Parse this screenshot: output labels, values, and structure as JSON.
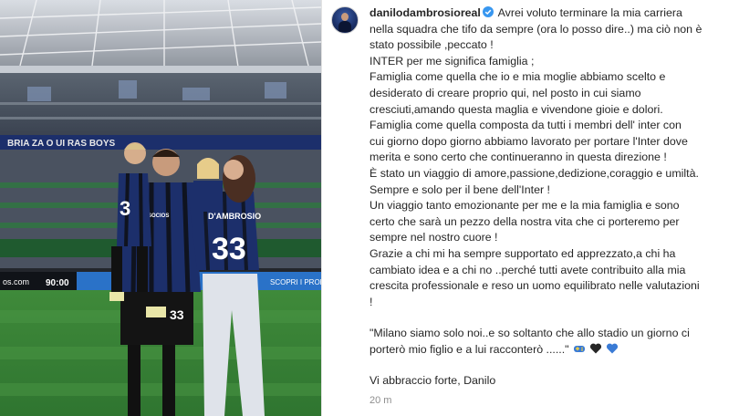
{
  "post": {
    "username": "danilodambrosioreal",
    "verified_color": "#3897f0",
    "caption_lines": [
      "Avrei voluto terminare la mia carriera",
      "nella squadra che tifo da sempre (ora lo posso dire..) ma ciò non è",
      "stato possibile ,peccato !",
      "INTER per me significa famiglia ;",
      "Famiglia come quella che io e mia moglie abbiamo scelto e",
      "desiderato di creare proprio qui, nel posto in cui siamo",
      "cresciuti,amando questa maglia e vivendone gioie e dolori.",
      "Famiglia come quella composta da tutti i membri dell' inter con",
      "cui giorno dopo giorno abbiamo lavorato per portare l'Inter dove",
      "merita e sono certo che continueranno in questa direzione !",
      "È stato un viaggio di amore,passione,dedizione,coraggio e umiltà.",
      "Sempre e solo per il bene dell'Inter !",
      "Un viaggio tanto emozionante per me e la mia famiglia e sono",
      "certo che sarà un pezzo della nostra vita che ci porteremo per",
      "sempre nel nostro cuore !",
      "Grazie a chi mi ha sempre supportato ed apprezzato,a chi ha",
      "cambiato idea e a chi no ..perché tutti avete contribuito alla mia",
      "crescita professionale e reso un uomo equilibrato nelle valutazioni",
      "!"
    ],
    "quote_lines": [
      "\"Milano siamo solo noi..e so soltanto che allo stadio un giorno ci",
      "porterò mio figlio e a lui racconterò ......\""
    ],
    "emojis": [
      "blue-yellow-gamepad-emoji",
      "black-heart-emoji",
      "blue-heart-emoji"
    ],
    "signoff": "Vi abbraccio forte, Danilo",
    "timestamp": "20 m"
  },
  "photo": {
    "banner_text": "BRIA ZA O UI RAS BOYS",
    "scoreboard_left": "os.com",
    "scoreboard_time": "90:00",
    "ad_text": "SCOPRI I PROD",
    "player_number": "33",
    "wife_shirt_name": "D'AMBROSIO",
    "wife_shirt_number": "33",
    "child_number": "3",
    "sponsor": "SOCIOS"
  },
  "colors": {
    "inter_blue": "#1c2f6b",
    "pitch_green": "#3f8a3a",
    "black_heart": "#262626",
    "blue_heart": "#3a7bd5"
  }
}
